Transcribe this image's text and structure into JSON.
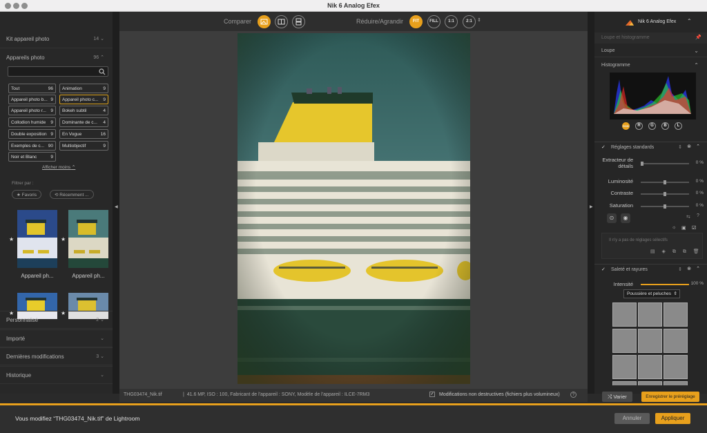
{
  "window": {
    "title": "Nik 6 Analog Efex"
  },
  "left": {
    "kit": {
      "label": "Kit appareil photo",
      "count": "14"
    },
    "appareils": {
      "label": "Appareils photo",
      "count": "96"
    },
    "search": {
      "placeholder": ""
    },
    "chips": [
      {
        "label": "Tout",
        "count": "96"
      },
      {
        "label": "Animation",
        "count": "9"
      },
      {
        "label": "Appareil photo b...",
        "count": "9"
      },
      {
        "label": "Appareil photo c...",
        "count": "9"
      },
      {
        "label": "Appareil photo r...",
        "count": "9"
      },
      {
        "label": "Bokeh subtil",
        "count": "4"
      },
      {
        "label": "Collodion humide",
        "count": "9"
      },
      {
        "label": "Dominante de c...",
        "count": "4"
      },
      {
        "label": "Double exposition",
        "count": "9"
      },
      {
        "label": "En Vogue",
        "count": "16"
      },
      {
        "label": "Exemples de c...",
        "count": "90"
      },
      {
        "label": "Multiobjectif",
        "count": "9"
      },
      {
        "label": "Noir et Blanc",
        "count": "9"
      }
    ],
    "show_less": "Afficher moins",
    "filter_label": "Filtrer par :",
    "filter_favorites": "Favoris",
    "filter_recent": "Récemment ...",
    "thumb_captions": [
      "Appareil ph...",
      "Appareil ph..."
    ],
    "sections": [
      {
        "label": "Personnalisé",
        "count": "2"
      },
      {
        "label": "Importé",
        "count": ""
      },
      {
        "label": "Dernières modifications",
        "count": "3"
      },
      {
        "label": "Historique",
        "count": ""
      }
    ]
  },
  "toolbar": {
    "compare_label": "Comparer",
    "zoom_label": "Réduire/Agrandir",
    "fit": "FIT",
    "fill": "FILL",
    "one": "1:1",
    "two": "2:1"
  },
  "status": {
    "filename": "THG03474_Nik.tif",
    "meta": "41.6 MP, ISO : 100, Fabricant de l'appareil : SONY, Modèle de l'appareil : ILCE-7RM3",
    "nondestructive": "Modifications non destructives (fichiers plus volumineux)"
  },
  "right": {
    "brand": "Nik 6 Analog Efex",
    "loupe_hist": "Loupe et histogramme",
    "loupe": "Loupe",
    "histogramme": "Histogramme",
    "channels": [
      "RGB",
      "R",
      "G",
      "B",
      "L"
    ],
    "standard": {
      "title": "Réglages standards",
      "sliders": [
        {
          "label": "Extracteur de détails",
          "value": "0 %",
          "level": 0.0
        },
        {
          "label": "Luminosité",
          "value": "0 %",
          "level": 0.5
        },
        {
          "label": "Contraste",
          "value": "0 %",
          "level": 0.5
        },
        {
          "label": "Saturation",
          "value": "0 %",
          "level": 0.5
        }
      ],
      "no_selective": "Il n'y a pas de réglages sélectifs"
    },
    "dirt": {
      "title": "Saleté et rayures",
      "intensity_label": "Intensité",
      "intensity_value": "100 %",
      "intensity_level": 1.0,
      "preset": "Poussière et peluches"
    },
    "vary": "Varier",
    "save_preset": "Enregistrer le préréglage"
  },
  "bottom": {
    "message": "Vous modifiez “THG03474_Nik.tif” de Lightroom",
    "cancel": "Annuler",
    "apply": "Appliquer"
  },
  "colors": {
    "accent": "#e8a01c"
  }
}
